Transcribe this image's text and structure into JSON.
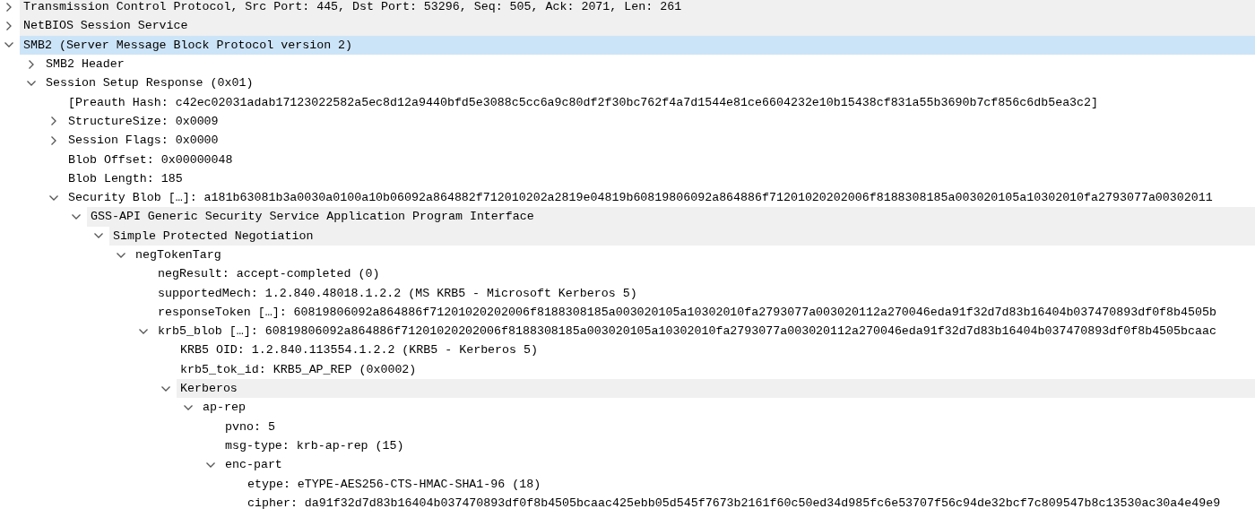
{
  "tree": [
    {
      "label": "Transmission Control Protocol, Src Port: 445, Dst Port: 53296, Seq: 505, Ack: 2071, Len: 261",
      "expanded": false,
      "selected": false,
      "shaded": true
    },
    {
      "label": "NetBIOS Session Service",
      "expanded": false,
      "selected": false,
      "shaded": true
    },
    {
      "label": "SMB2 (Server Message Block Protocol version 2)",
      "expanded": true,
      "selected": true,
      "shaded": false,
      "children": [
        {
          "label": "SMB2 Header",
          "expanded": false,
          "selected": false,
          "shaded": false
        },
        {
          "label": "Session Setup Response (0x01)",
          "expanded": true,
          "selected": false,
          "shaded": false,
          "children": [
            {
              "label": "[Preauth Hash: c42ec02031adab17123022582a5ec8d12a9440bfd5e3088c5cc6a9c80df2f30bc762f4a7d1544e81ce6604232e10b15438cf831a55b3690b7cf856c6db5ea3c2]",
              "selected": false,
              "shaded": false
            },
            {
              "label": "StructureSize: 0x0009",
              "expanded": false,
              "selected": false,
              "shaded": false
            },
            {
              "label": "Session Flags: 0x0000",
              "expanded": false,
              "selected": false,
              "shaded": false
            },
            {
              "label": "Blob Offset: 0x00000048",
              "selected": false,
              "shaded": false
            },
            {
              "label": "Blob Length: 185",
              "selected": false,
              "shaded": false
            },
            {
              "label": "Security Blob […]: a181b63081b3a0030a0100a10b06092a864882f712010202a2819e04819b60819806092a864886f71201020202006f8188308185a003020105a10302010fa2793077a00302011",
              "expanded": true,
              "selected": false,
              "shaded": false,
              "children": [
                {
                  "label": "GSS-API Generic Security Service Application Program Interface",
                  "expanded": true,
                  "selected": false,
                  "shaded": true,
                  "children": [
                    {
                      "label": "Simple Protected Negotiation",
                      "expanded": true,
                      "selected": false,
                      "shaded": true,
                      "children": [
                        {
                          "label": "negTokenTarg",
                          "expanded": true,
                          "selected": false,
                          "shaded": false,
                          "children": [
                            {
                              "label": "negResult: accept-completed (0)",
                              "selected": false,
                              "shaded": false
                            },
                            {
                              "label": "supportedMech: 1.2.840.48018.1.2.2 (MS KRB5 - Microsoft Kerberos 5)",
                              "selected": false,
                              "shaded": false
                            },
                            {
                              "label": "responseToken […]: 60819806092a864886f71201020202006f8188308185a003020105a10302010fa2793077a003020112a270046eda91f32d7d83b16404b037470893df0f8b4505b",
                              "selected": false,
                              "shaded": false
                            },
                            {
                              "label": "krb5_blob […]: 60819806092a864886f71201020202006f8188308185a003020105a10302010fa2793077a003020112a270046eda91f32d7d83b16404b037470893df0f8b4505bcaac",
                              "expanded": true,
                              "selected": false,
                              "shaded": false,
                              "children": [
                                {
                                  "label": "KRB5 OID: 1.2.840.113554.1.2.2 (KRB5 - Kerberos 5)",
                                  "selected": false,
                                  "shaded": false
                                },
                                {
                                  "label": "krb5_tok_id: KRB5_AP_REP (0x0002)",
                                  "selected": false,
                                  "shaded": false
                                },
                                {
                                  "label": "Kerberos",
                                  "expanded": true,
                                  "selected": false,
                                  "shaded": true,
                                  "children": [
                                    {
                                      "label": "ap-rep",
                                      "expanded": true,
                                      "selected": false,
                                      "shaded": false,
                                      "children": [
                                        {
                                          "label": "pvno: 5",
                                          "selected": false,
                                          "shaded": false
                                        },
                                        {
                                          "label": "msg-type: krb-ap-rep (15)",
                                          "selected": false,
                                          "shaded": false
                                        },
                                        {
                                          "label": "enc-part",
                                          "expanded": true,
                                          "selected": false,
                                          "shaded": false,
                                          "children": [
                                            {
                                              "label": "etype: eTYPE-AES256-CTS-HMAC-SHA1-96 (18)",
                                              "selected": false,
                                              "shaded": false
                                            },
                                            {
                                              "label": "cipher: da91f32d7d83b16404b037470893df0f8b4505bcaac425ebb05d545f7673b2161f60c50ed34d985fc6e53707f56c94de32bcf7c809547b8c13530ac30a4e49e9",
                                              "selected": false,
                                              "shaded": false
                                            }
                                          ]
                                        }
                                      ]
                                    }
                                  ]
                                }
                              ]
                            }
                          ]
                        }
                      ]
                    }
                  ]
                }
              ]
            }
          ]
        }
      ]
    }
  ]
}
